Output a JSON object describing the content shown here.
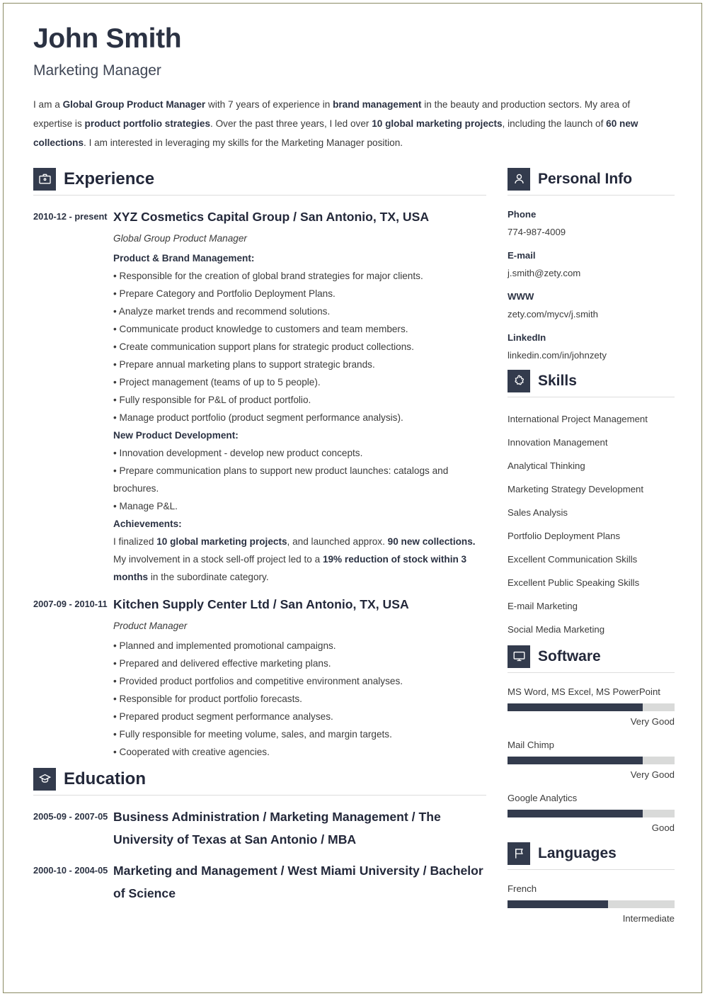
{
  "header": {
    "name": "John Smith",
    "job_title": "Marketing Manager",
    "summary_parts": [
      {
        "t": "I am a ",
        "b": false
      },
      {
        "t": "Global Group Product Manager",
        "b": true
      },
      {
        "t": " with 7 years of experience in ",
        "b": false
      },
      {
        "t": "brand management",
        "b": true
      },
      {
        "t": " in the beauty and production sectors. My area of expertise is ",
        "b": false
      },
      {
        "t": "product portfolio strategies",
        "b": true
      },
      {
        "t": ". Over the past three years, I led over ",
        "b": false
      },
      {
        "t": "10 global marketing projects",
        "b": true
      },
      {
        "t": ", including the launch of ",
        "b": false
      },
      {
        "t": "60 new collections",
        "b": true
      },
      {
        "t": ". I am interested in leveraging my skills for the Marketing Manager position.",
        "b": false
      }
    ]
  },
  "experience": {
    "heading": "Experience",
    "icon": "briefcase-icon",
    "entries": [
      {
        "date": "2010-12 - present",
        "title": "XYZ Cosmetics Capital Group / San Antonio, TX, USA",
        "subtitle": "Global Group Product Manager",
        "groups": [
          {
            "label": "Product & Brand Management:",
            "bullets": [
              "• Responsible for the creation of global brand strategies for major clients.",
              "• Prepare Category and Portfolio Deployment Plans.",
              "• Analyze market trends and recommend solutions.",
              "• Communicate product knowledge to customers and team members.",
              "• Create communication support plans for strategic product collections.",
              "• Prepare annual marketing plans to support strategic brands.",
              "• Project management (teams of up to 5 people).",
              "• Fully responsible for P&L of product portfolio.",
              "• Manage product portfolio (product segment performance analysis)."
            ]
          },
          {
            "label": "New Product Development:",
            "bullets": [
              "• Innovation development - develop new product concepts.",
              "• Prepare communication plans to support new product launches: catalogs and brochures.",
              "• Manage P&L."
            ]
          }
        ],
        "achievements_label": "Achievements:",
        "achievements": [
          [
            {
              "t": "I finalized ",
              "b": false
            },
            {
              "t": "10 global marketing projects",
              "b": true
            },
            {
              "t": ", and launched approx. ",
              "b": false
            },
            {
              "t": "90 new collections.",
              "b": true
            }
          ],
          [
            {
              "t": "My involvement in a stock sell-off project led to a ",
              "b": false
            },
            {
              "t": "19% reduction of stock within 3 months",
              "b": true
            },
            {
              "t": " in the subordinate category.",
              "b": false
            }
          ]
        ]
      },
      {
        "date": "2007-09 - 2010-11",
        "title": "Kitchen Supply Center Ltd / San Antonio, TX, USA",
        "subtitle": "Product Manager",
        "groups": [
          {
            "label": "",
            "bullets": [
              "• Planned and implemented promotional campaigns.",
              "• Prepared and delivered effective marketing plans.",
              "• Provided product portfolios and competitive environment analyses.",
              "• Responsible for product portfolio forecasts.",
              "• Prepared product segment performance analyses.",
              "• Fully responsible for meeting volume, sales, and margin targets.",
              "• Cooperated with creative agencies."
            ]
          }
        ],
        "achievements_label": "",
        "achievements": []
      }
    ]
  },
  "education": {
    "heading": "Education",
    "icon": "graduation-cap-icon",
    "entries": [
      {
        "date": "2005-09 - 2007-05",
        "title": "Business Administration / Marketing Management / The University of Texas at San Antonio / MBA"
      },
      {
        "date": "2000-10 - 2004-05",
        "title": "Marketing and Management / West Miami University / Bachelor of Science"
      }
    ]
  },
  "personal_info": {
    "heading": "Personal Info",
    "icon": "user-icon",
    "fields": [
      {
        "label": "Phone",
        "value": "774-987-4009"
      },
      {
        "label": "E-mail",
        "value": "j.smith@zety.com"
      },
      {
        "label": "WWW",
        "value": "zety.com/mycv/j.smith"
      },
      {
        "label": "LinkedIn",
        "value": "linkedin.com/in/johnzety"
      }
    ]
  },
  "skills": {
    "heading": "Skills",
    "icon": "puzzle-piece-icon",
    "items": [
      "International Project Management",
      "Innovation Management",
      "Analytical Thinking",
      "Marketing Strategy Development",
      "Sales Analysis",
      "Portfolio Deployment Plans",
      "Excellent Communication Skills",
      "Excellent Public Speaking Skills",
      "E-mail Marketing",
      "Social Media Marketing"
    ]
  },
  "software": {
    "heading": "Software",
    "icon": "monitor-icon",
    "items": [
      {
        "name": "MS Word, MS Excel, MS PowerPoint",
        "level": "Very Good",
        "percent": 81
      },
      {
        "name": "Mail Chimp",
        "level": "Very Good",
        "percent": 81
      },
      {
        "name": "Google Analytics",
        "level": "Good",
        "percent": 81
      }
    ]
  },
  "languages": {
    "heading": "Languages",
    "icon": "flag-icon",
    "items": [
      {
        "name": "French",
        "level": "Intermediate",
        "percent": 60
      }
    ]
  },
  "colors": {
    "accent_dark": "#333b4d",
    "heading": "#23283a",
    "text": "#3b3b3b",
    "bar_track": "#d9dad9",
    "page_border": "#8a8a63"
  }
}
